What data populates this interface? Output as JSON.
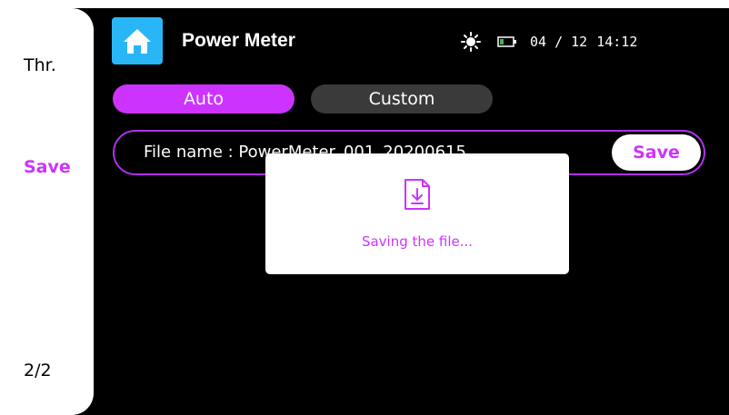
{
  "sidebar": {
    "items": [
      {
        "label": "Thr."
      },
      {
        "label": "Save"
      }
    ],
    "page_indicator": "2/2"
  },
  "header": {
    "title": "Power Meter",
    "home_icon": "home-icon",
    "status": {
      "brightness_icon": "brightness-icon",
      "battery_icon": "battery-icon",
      "date": "04 / 12",
      "time": "14:12"
    }
  },
  "tabs": [
    {
      "label": "Auto",
      "active": true
    },
    {
      "label": "Custom",
      "active": false
    }
  ],
  "file": {
    "label": "File name : PowerMeter_001_20200615",
    "save_label": "Save"
  },
  "dialog": {
    "icon": "file-download-icon",
    "message": "Saving the file..."
  },
  "colors": {
    "accent": "#cc33ff",
    "home_button": "#29b6f6",
    "background": "#000000",
    "inactive_tab": "#3a3a3a"
  }
}
